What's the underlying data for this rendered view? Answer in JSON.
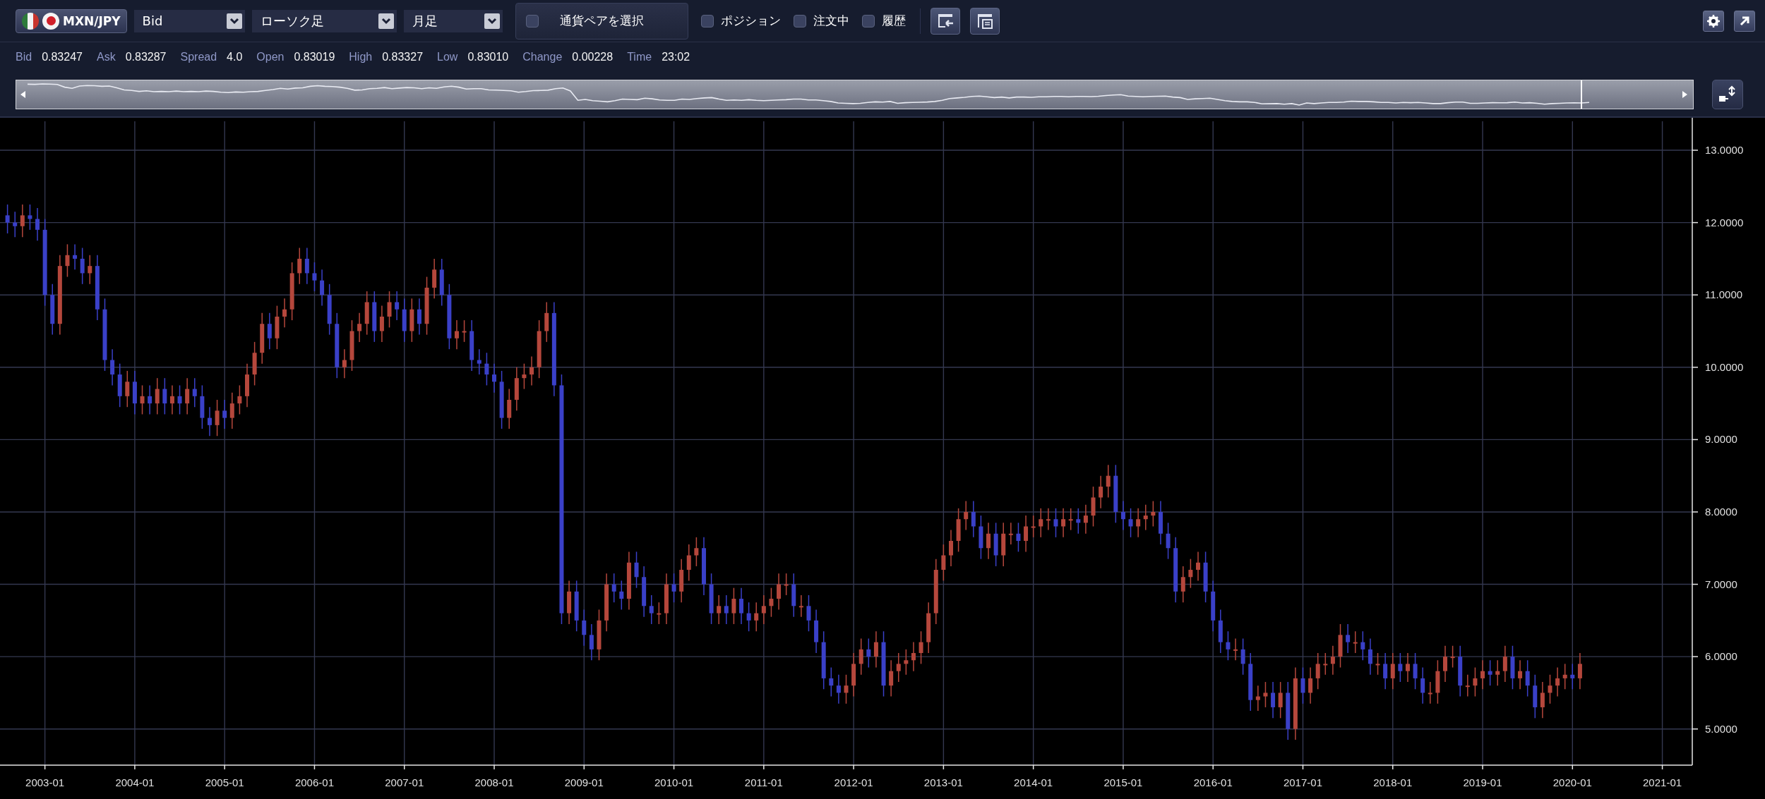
{
  "toolbar": {
    "pair_button": {
      "label": "MXN/JPY"
    },
    "dropdowns": [
      {
        "value": "Bid"
      },
      {
        "value": "ローソク足"
      },
      {
        "value": "月足"
      }
    ],
    "pair_select": {
      "label": "通貨ペアを選択",
      "checked": false
    },
    "toggles": [
      {
        "label": "ポジション",
        "checked": false
      },
      {
        "label": "注文中",
        "checked": false
      },
      {
        "label": "履歴",
        "checked": false
      }
    ]
  },
  "quote": [
    {
      "label": "Bid",
      "value": "0.83247"
    },
    {
      "label": "Ask",
      "value": "0.83287"
    },
    {
      "label": "Spread",
      "value": "4.0"
    },
    {
      "label": "Open",
      "value": "0.83019"
    },
    {
      "label": "High",
      "value": "0.83327"
    },
    {
      "label": "Low",
      "value": "0.83010"
    },
    {
      "label": "Change",
      "value": "0.00228"
    },
    {
      "label": "Time",
      "value": "23:02"
    }
  ],
  "chart": {
    "chart_data": {
      "type": "candlestick",
      "grid": true,
      "ylim": [
        4.5,
        13.4
      ],
      "yticks": [
        {
          "value": 5,
          "label": "5.0000"
        },
        {
          "value": 6,
          "label": "6.0000"
        },
        {
          "value": 7,
          "label": "7.0000"
        },
        {
          "value": 8,
          "label": "8.0000"
        },
        {
          "value": 9,
          "label": "9.0000"
        },
        {
          "value": 10,
          "label": "10.0000"
        },
        {
          "value": 11,
          "label": "11.0000"
        },
        {
          "value": 12,
          "label": "12.0000"
        },
        {
          "value": 13,
          "label": "13.0000"
        }
      ],
      "categories": [
        null,
        null,
        null,
        null,
        null,
        "2003-01",
        null,
        null,
        null,
        null,
        null,
        null,
        null,
        null,
        null,
        null,
        null,
        "2004-01",
        null,
        null,
        null,
        null,
        null,
        null,
        null,
        null,
        null,
        null,
        null,
        "2005-01",
        null,
        null,
        null,
        null,
        null,
        null,
        null,
        null,
        null,
        null,
        null,
        "2006-01",
        null,
        null,
        null,
        null,
        null,
        null,
        null,
        null,
        null,
        null,
        null,
        "2007-01",
        null,
        null,
        null,
        null,
        null,
        null,
        null,
        null,
        null,
        null,
        null,
        "2008-01",
        null,
        null,
        null,
        null,
        null,
        null,
        null,
        null,
        null,
        null,
        null,
        "2009-01",
        null,
        null,
        null,
        null,
        null,
        null,
        null,
        null,
        null,
        null,
        null,
        "2010-01",
        null,
        null,
        null,
        null,
        null,
        null,
        null,
        null,
        null,
        null,
        null,
        "2011-01",
        null,
        null,
        null,
        null,
        null,
        null,
        null,
        null,
        null,
        null,
        null,
        "2012-01",
        null,
        null,
        null,
        null,
        null,
        null,
        null,
        null,
        null,
        null,
        null,
        "2013-01",
        null,
        null,
        null,
        null,
        null,
        null,
        null,
        null,
        null,
        null,
        null,
        "2014-01",
        null,
        null,
        null,
        null,
        null,
        null,
        null,
        null,
        null,
        null,
        null,
        "2015-01",
        null,
        null,
        null,
        null,
        null,
        null,
        null,
        null,
        null,
        null,
        null,
        "2016-01",
        null,
        null,
        null,
        null,
        null,
        null,
        null,
        null,
        null,
        null,
        null,
        "2017-01",
        null,
        null,
        null,
        null,
        null,
        null,
        null,
        null,
        null,
        null,
        null,
        "2018-01",
        null,
        null,
        null,
        null,
        null,
        null,
        null,
        null,
        null,
        null,
        null,
        "2019-01",
        null,
        null,
        null,
        null,
        null,
        null,
        null,
        null,
        null,
        null,
        null,
        "2020-01",
        null,
        null,
        null,
        null,
        null,
        null,
        null,
        null,
        null,
        null,
        null,
        "2021-01"
      ],
      "ohlc": [
        [
          12.1,
          12.25,
          11.85,
          12.0
        ],
        [
          12.0,
          12.15,
          11.8,
          11.95
        ],
        [
          11.95,
          12.25,
          11.8,
          12.1
        ],
        [
          12.1,
          12.25,
          11.9,
          12.05
        ],
        [
          12.05,
          12.2,
          11.75,
          11.9
        ],
        [
          11.9,
          12.05,
          10.85,
          11.0
        ],
        [
          11.0,
          11.15,
          10.45,
          10.6
        ],
        [
          10.6,
          11.55,
          10.45,
          11.4
        ],
        [
          11.4,
          11.7,
          11.25,
          11.55
        ],
        [
          11.55,
          11.7,
          11.35,
          11.5
        ],
        [
          11.5,
          11.65,
          11.15,
          11.3
        ],
        [
          11.3,
          11.55,
          11.15,
          11.4
        ],
        [
          11.4,
          11.55,
          10.65,
          10.8
        ],
        [
          10.8,
          10.95,
          9.95,
          10.1
        ],
        [
          10.1,
          10.25,
          9.75,
          9.9
        ],
        [
          9.9,
          10.05,
          9.45,
          9.6
        ],
        [
          9.6,
          9.95,
          9.45,
          9.8
        ],
        [
          9.8,
          9.95,
          9.35,
          9.5
        ],
        [
          9.5,
          9.75,
          9.35,
          9.6
        ],
        [
          9.6,
          9.75,
          9.35,
          9.5
        ],
        [
          9.5,
          9.85,
          9.35,
          9.7
        ],
        [
          9.7,
          9.85,
          9.35,
          9.5
        ],
        [
          9.5,
          9.75,
          9.35,
          9.6
        ],
        [
          9.6,
          9.75,
          9.35,
          9.5
        ],
        [
          9.5,
          9.85,
          9.35,
          9.7
        ],
        [
          9.7,
          9.85,
          9.45,
          9.6
        ],
        [
          9.6,
          9.75,
          9.15,
          9.3
        ],
        [
          9.3,
          9.45,
          9.05,
          9.2
        ],
        [
          9.2,
          9.55,
          9.05,
          9.4
        ],
        [
          9.4,
          9.55,
          9.15,
          9.3
        ],
        [
          9.3,
          9.65,
          9.15,
          9.5
        ],
        [
          9.5,
          9.75,
          9.35,
          9.6
        ],
        [
          9.6,
          10.05,
          9.45,
          9.9
        ],
        [
          9.9,
          10.35,
          9.75,
          10.2
        ],
        [
          10.2,
          10.75,
          10.05,
          10.6
        ],
        [
          10.6,
          10.75,
          10.25,
          10.4
        ],
        [
          10.4,
          10.85,
          10.25,
          10.7
        ],
        [
          10.7,
          10.95,
          10.55,
          10.8
        ],
        [
          10.8,
          11.45,
          10.65,
          11.3
        ],
        [
          11.3,
          11.65,
          11.15,
          11.5
        ],
        [
          11.5,
          11.65,
          11.15,
          11.3
        ],
        [
          11.3,
          11.45,
          11.05,
          11.2
        ],
        [
          11.2,
          11.35,
          10.85,
          11.0
        ],
        [
          11.0,
          11.15,
          10.45,
          10.6
        ],
        [
          10.6,
          10.75,
          9.85,
          10.0
        ],
        [
          10.0,
          10.25,
          9.85,
          10.1
        ],
        [
          10.1,
          10.65,
          9.95,
          10.5
        ],
        [
          10.5,
          10.75,
          10.35,
          10.6
        ],
        [
          10.6,
          11.05,
          10.45,
          10.9
        ],
        [
          10.9,
          11.05,
          10.35,
          10.5
        ],
        [
          10.5,
          10.85,
          10.35,
          10.7
        ],
        [
          10.7,
          11.05,
          10.55,
          10.9
        ],
        [
          10.9,
          11.05,
          10.65,
          10.8
        ],
        [
          10.8,
          10.95,
          10.35,
          10.5
        ],
        [
          10.5,
          10.95,
          10.35,
          10.8
        ],
        [
          10.8,
          10.95,
          10.45,
          10.6
        ],
        [
          10.6,
          11.25,
          10.45,
          11.1
        ],
        [
          11.1,
          11.5,
          10.95,
          11.35
        ],
        [
          11.35,
          11.5,
          10.85,
          11.0
        ],
        [
          11.0,
          11.15,
          10.25,
          10.4
        ],
        [
          10.4,
          10.65,
          10.25,
          10.5
        ],
        [
          10.5,
          10.65,
          10.35,
          10.5
        ],
        [
          10.5,
          10.65,
          9.95,
          10.1
        ],
        [
          10.1,
          10.25,
          9.9,
          10.05
        ],
        [
          10.05,
          10.2,
          9.75,
          9.9
        ],
        [
          9.9,
          10.05,
          9.65,
          9.8
        ],
        [
          9.8,
          9.95,
          9.15,
          9.3
        ],
        [
          9.3,
          9.7,
          9.15,
          9.55
        ],
        [
          9.55,
          10.0,
          9.4,
          9.85
        ],
        [
          9.85,
          10.05,
          9.7,
          9.9
        ],
        [
          9.9,
          10.15,
          9.75,
          10.0
        ],
        [
          10.0,
          10.65,
          9.85,
          10.5
        ],
        [
          10.5,
          10.9,
          10.35,
          10.75
        ],
        [
          10.75,
          10.9,
          9.6,
          9.75
        ],
        [
          9.75,
          9.9,
          6.45,
          6.6
        ],
        [
          6.6,
          7.05,
          6.45,
          6.9
        ],
        [
          6.9,
          7.05,
          6.35,
          6.5
        ],
        [
          6.5,
          6.65,
          6.15,
          6.3
        ],
        [
          6.3,
          6.45,
          5.95,
          6.1
        ],
        [
          6.1,
          6.65,
          5.95,
          6.5
        ],
        [
          6.5,
          7.15,
          6.35,
          7.0
        ],
        [
          7.0,
          7.15,
          6.75,
          6.9
        ],
        [
          6.9,
          7.05,
          6.65,
          6.8
        ],
        [
          6.8,
          7.45,
          6.65,
          7.3
        ],
        [
          7.3,
          7.45,
          6.95,
          7.1
        ],
        [
          7.1,
          7.25,
          6.55,
          6.7
        ],
        [
          6.7,
          6.85,
          6.45,
          6.6
        ],
        [
          6.6,
          6.75,
          6.45,
          6.6
        ],
        [
          6.6,
          7.15,
          6.45,
          7.0
        ],
        [
          7.0,
          7.15,
          6.75,
          6.9
        ],
        [
          6.9,
          7.35,
          6.75,
          7.2
        ],
        [
          7.2,
          7.55,
          7.05,
          7.4
        ],
        [
          7.4,
          7.65,
          7.25,
          7.5
        ],
        [
          7.5,
          7.65,
          6.85,
          7.0
        ],
        [
          7.0,
          7.15,
          6.45,
          6.6
        ],
        [
          6.6,
          6.85,
          6.45,
          6.7
        ],
        [
          6.7,
          6.85,
          6.45,
          6.6
        ],
        [
          6.6,
          6.95,
          6.45,
          6.8
        ],
        [
          6.8,
          6.95,
          6.45,
          6.6
        ],
        [
          6.6,
          6.75,
          6.35,
          6.5
        ],
        [
          6.5,
          6.75,
          6.35,
          6.6
        ],
        [
          6.6,
          6.85,
          6.45,
          6.7
        ],
        [
          6.7,
          6.95,
          6.55,
          6.8
        ],
        [
          6.8,
          7.15,
          6.65,
          7.0
        ],
        [
          7.0,
          7.15,
          6.85,
          7.0
        ],
        [
          7.0,
          7.15,
          6.55,
          6.7
        ],
        [
          6.7,
          6.85,
          6.55,
          6.7
        ],
        [
          6.7,
          6.85,
          6.35,
          6.5
        ],
        [
          6.5,
          6.65,
          6.05,
          6.2
        ],
        [
          6.2,
          6.35,
          5.55,
          5.7
        ],
        [
          5.7,
          5.85,
          5.45,
          5.6
        ],
        [
          5.6,
          5.75,
          5.35,
          5.5
        ],
        [
          5.5,
          5.75,
          5.35,
          5.6
        ],
        [
          5.6,
          6.05,
          5.45,
          5.9
        ],
        [
          5.9,
          6.25,
          5.75,
          6.1
        ],
        [
          6.1,
          6.25,
          5.85,
          6.0
        ],
        [
          6.0,
          6.35,
          5.85,
          6.2
        ],
        [
          6.2,
          6.35,
          5.45,
          5.6
        ],
        [
          5.6,
          5.95,
          5.45,
          5.8
        ],
        [
          5.8,
          6.05,
          5.65,
          5.9
        ],
        [
          5.9,
          6.1,
          5.75,
          5.95
        ],
        [
          5.95,
          6.2,
          5.8,
          6.05
        ],
        [
          6.05,
          6.35,
          5.9,
          6.2
        ],
        [
          6.2,
          6.75,
          6.05,
          6.6
        ],
        [
          6.6,
          7.35,
          6.45,
          7.2
        ],
        [
          7.2,
          7.55,
          7.05,
          7.4
        ],
        [
          7.4,
          7.75,
          7.25,
          7.6
        ],
        [
          7.6,
          8.05,
          7.45,
          7.9
        ],
        [
          7.9,
          8.15,
          7.75,
          8.0
        ],
        [
          8.0,
          8.15,
          7.65,
          7.8
        ],
        [
          7.8,
          7.95,
          7.35,
          7.5
        ],
        [
          7.5,
          7.85,
          7.35,
          7.7
        ],
        [
          7.7,
          7.85,
          7.25,
          7.4
        ],
        [
          7.4,
          7.85,
          7.25,
          7.7
        ],
        [
          7.7,
          7.85,
          7.55,
          7.7
        ],
        [
          7.7,
          7.85,
          7.45,
          7.6
        ],
        [
          7.6,
          7.95,
          7.45,
          7.8
        ],
        [
          7.8,
          7.95,
          7.65,
          7.8
        ],
        [
          7.8,
          8.05,
          7.65,
          7.9
        ],
        [
          7.9,
          8.05,
          7.75,
          7.9
        ],
        [
          7.9,
          8.05,
          7.65,
          7.8
        ],
        [
          7.8,
          8.05,
          7.65,
          7.9
        ],
        [
          7.9,
          8.05,
          7.75,
          7.9
        ],
        [
          7.9,
          8.05,
          7.7,
          7.85
        ],
        [
          7.85,
          8.1,
          7.7,
          7.95
        ],
        [
          7.95,
          8.35,
          7.8,
          8.2
        ],
        [
          8.2,
          8.5,
          8.05,
          8.35
        ],
        [
          8.35,
          8.65,
          8.2,
          8.5
        ],
        [
          8.5,
          8.65,
          7.85,
          8.0
        ],
        [
          8.0,
          8.15,
          7.75,
          7.9
        ],
        [
          7.9,
          8.05,
          7.65,
          7.8
        ],
        [
          7.8,
          8.05,
          7.65,
          7.9
        ],
        [
          7.9,
          8.1,
          7.75,
          7.95
        ],
        [
          7.95,
          8.15,
          7.8,
          8.0
        ],
        [
          8.0,
          8.15,
          7.55,
          7.7
        ],
        [
          7.7,
          7.85,
          7.35,
          7.5
        ],
        [
          7.5,
          7.65,
          6.75,
          6.9
        ],
        [
          6.9,
          7.25,
          6.75,
          7.1
        ],
        [
          7.1,
          7.35,
          6.95,
          7.2
        ],
        [
          7.2,
          7.45,
          7.05,
          7.3
        ],
        [
          7.3,
          7.45,
          6.75,
          6.9
        ],
        [
          6.9,
          7.05,
          6.35,
          6.5
        ],
        [
          6.5,
          6.65,
          6.05,
          6.2
        ],
        [
          6.2,
          6.35,
          5.95,
          6.1
        ],
        [
          6.1,
          6.25,
          5.95,
          6.1
        ],
        [
          6.1,
          6.25,
          5.75,
          5.9
        ],
        [
          5.9,
          6.05,
          5.25,
          5.4
        ],
        [
          5.4,
          5.6,
          5.25,
          5.45
        ],
        [
          5.45,
          5.65,
          5.3,
          5.5
        ],
        [
          5.5,
          5.65,
          5.15,
          5.3
        ],
        [
          5.3,
          5.65,
          5.15,
          5.5
        ],
        [
          5.5,
          5.65,
          4.85,
          5.0
        ],
        [
          5.0,
          5.85,
          4.85,
          5.7
        ],
        [
          5.7,
          5.85,
          5.35,
          5.5
        ],
        [
          5.5,
          5.85,
          5.35,
          5.7
        ],
        [
          5.7,
          6.05,
          5.55,
          5.9
        ],
        [
          5.9,
          6.05,
          5.75,
          5.9
        ],
        [
          5.9,
          6.15,
          5.75,
          6.0
        ],
        [
          6.0,
          6.45,
          5.85,
          6.3
        ],
        [
          6.3,
          6.45,
          6.05,
          6.2
        ],
        [
          6.2,
          6.35,
          6.05,
          6.2
        ],
        [
          6.2,
          6.35,
          5.95,
          6.1
        ],
        [
          6.1,
          6.25,
          5.75,
          5.9
        ],
        [
          5.9,
          6.05,
          5.75,
          5.9
        ],
        [
          5.9,
          6.05,
          5.55,
          5.7
        ],
        [
          5.7,
          6.05,
          5.55,
          5.9
        ],
        [
          5.9,
          6.05,
          5.65,
          5.8
        ],
        [
          5.8,
          6.05,
          5.65,
          5.9
        ],
        [
          5.9,
          6.05,
          5.55,
          5.7
        ],
        [
          5.7,
          5.85,
          5.35,
          5.5
        ],
        [
          5.5,
          5.65,
          5.35,
          5.5
        ],
        [
          5.5,
          5.95,
          5.35,
          5.8
        ],
        [
          5.8,
          6.15,
          5.65,
          6.0
        ],
        [
          6.0,
          6.15,
          5.85,
          6.0
        ],
        [
          6.0,
          6.15,
          5.45,
          5.6
        ],
        [
          5.6,
          5.75,
          5.45,
          5.6
        ],
        [
          5.6,
          5.85,
          5.45,
          5.7
        ],
        [
          5.7,
          5.95,
          5.55,
          5.8
        ],
        [
          5.8,
          5.95,
          5.6,
          5.75
        ],
        [
          5.75,
          5.95,
          5.6,
          5.8
        ],
        [
          5.8,
          6.15,
          5.65,
          6.0
        ],
        [
          6.0,
          6.15,
          5.55,
          5.7
        ],
        [
          5.7,
          5.95,
          5.55,
          5.8
        ],
        [
          5.8,
          5.95,
          5.45,
          5.6
        ],
        [
          5.6,
          5.75,
          5.15,
          5.3
        ],
        [
          5.3,
          5.65,
          5.15,
          5.5
        ],
        [
          5.5,
          5.75,
          5.35,
          5.6
        ],
        [
          5.6,
          5.85,
          5.45,
          5.7
        ],
        [
          5.7,
          5.9,
          5.55,
          5.75
        ],
        [
          5.75,
          5.9,
          5.55,
          5.7
        ],
        [
          5.7,
          6.05,
          5.55,
          5.9
        ],
        null,
        null,
        null,
        null,
        null,
        null,
        null,
        null,
        null,
        null,
        null
      ]
    }
  }
}
